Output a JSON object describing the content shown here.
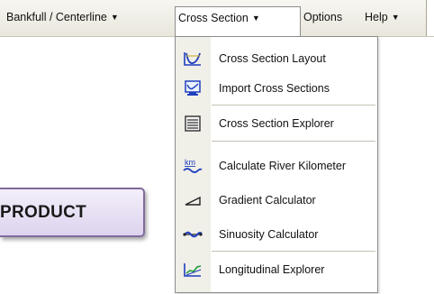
{
  "menubar": {
    "items": [
      {
        "label": "Bankfull / Centerline",
        "has_arrow": true
      },
      {
        "label": "Cross Section",
        "has_arrow": true,
        "open": true
      },
      {
        "label": "Options",
        "has_arrow": false
      },
      {
        "label": "Help",
        "has_arrow": true
      }
    ],
    "arrow_glyph": "▼"
  },
  "dropdown": {
    "items": [
      {
        "label": "Cross Section Layout",
        "icon": "cross-section-layout-icon"
      },
      {
        "label": "Import Cross Sections",
        "icon": "import-cross-sections-icon"
      },
      {
        "label": "Cross Section Explorer",
        "icon": "cross-section-explorer-icon"
      },
      {
        "label": "Calculate River Kilometer",
        "icon": "river-kilometer-icon"
      },
      {
        "label": "Gradient Calculator",
        "icon": "gradient-calculator-icon"
      },
      {
        "label": "Sinuosity Calculator",
        "icon": "sinuosity-calculator-icon"
      },
      {
        "label": "Longitudinal Explorer",
        "icon": "longitudinal-explorer-icon"
      }
    ]
  },
  "product_button": {
    "label": "PRODUCT"
  },
  "colors": {
    "accent_purple": "#7f6a9c",
    "menu_blue": "#1a3cb0"
  }
}
